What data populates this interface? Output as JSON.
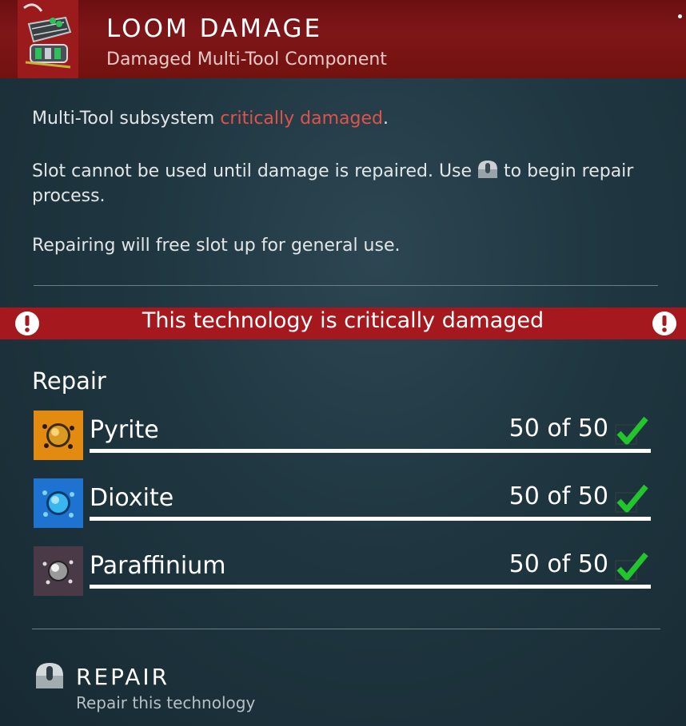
{
  "header": {
    "title": "LOOM DAMAGE",
    "subtitle": "Damaged Multi-Tool Component",
    "icon": "damaged-component-icon"
  },
  "description": {
    "line1_prefix": "Multi-Tool subsystem ",
    "line1_highlight": "critically damaged",
    "line1_suffix": ".",
    "line2_before_icon": "Slot cannot be used until damage is repaired. Use",
    "line2_after_icon": "to begin repair process.",
    "line2_icon": "mouse-button-icon",
    "line3": "Repairing will free slot up for general use."
  },
  "warning": {
    "text": "This technology is critically damaged",
    "icon": "exclamation-icon"
  },
  "repair": {
    "heading": "Repair",
    "resources": [
      {
        "name": "Pyrite",
        "count": "50 of 50",
        "progress": 1.0,
        "icon": "pyrite-icon",
        "color": "#e38a10"
      },
      {
        "name": "Dioxite",
        "count": "50 of 50",
        "progress": 1.0,
        "icon": "dioxite-icon",
        "color": "#1e73d0"
      },
      {
        "name": "Paraffinium",
        "count": "50 of 50",
        "progress": 1.0,
        "icon": "paraffinium-icon",
        "color": "#4a3a48"
      }
    ]
  },
  "action": {
    "label": "REPAIR",
    "description": "Repair this technology",
    "icon": "mouse-button-icon"
  },
  "colors": {
    "header_bg": "#7a1517",
    "warning_bg": "#a5191e",
    "highlight_text": "#e0534b",
    "check_green": "#22c52c"
  }
}
